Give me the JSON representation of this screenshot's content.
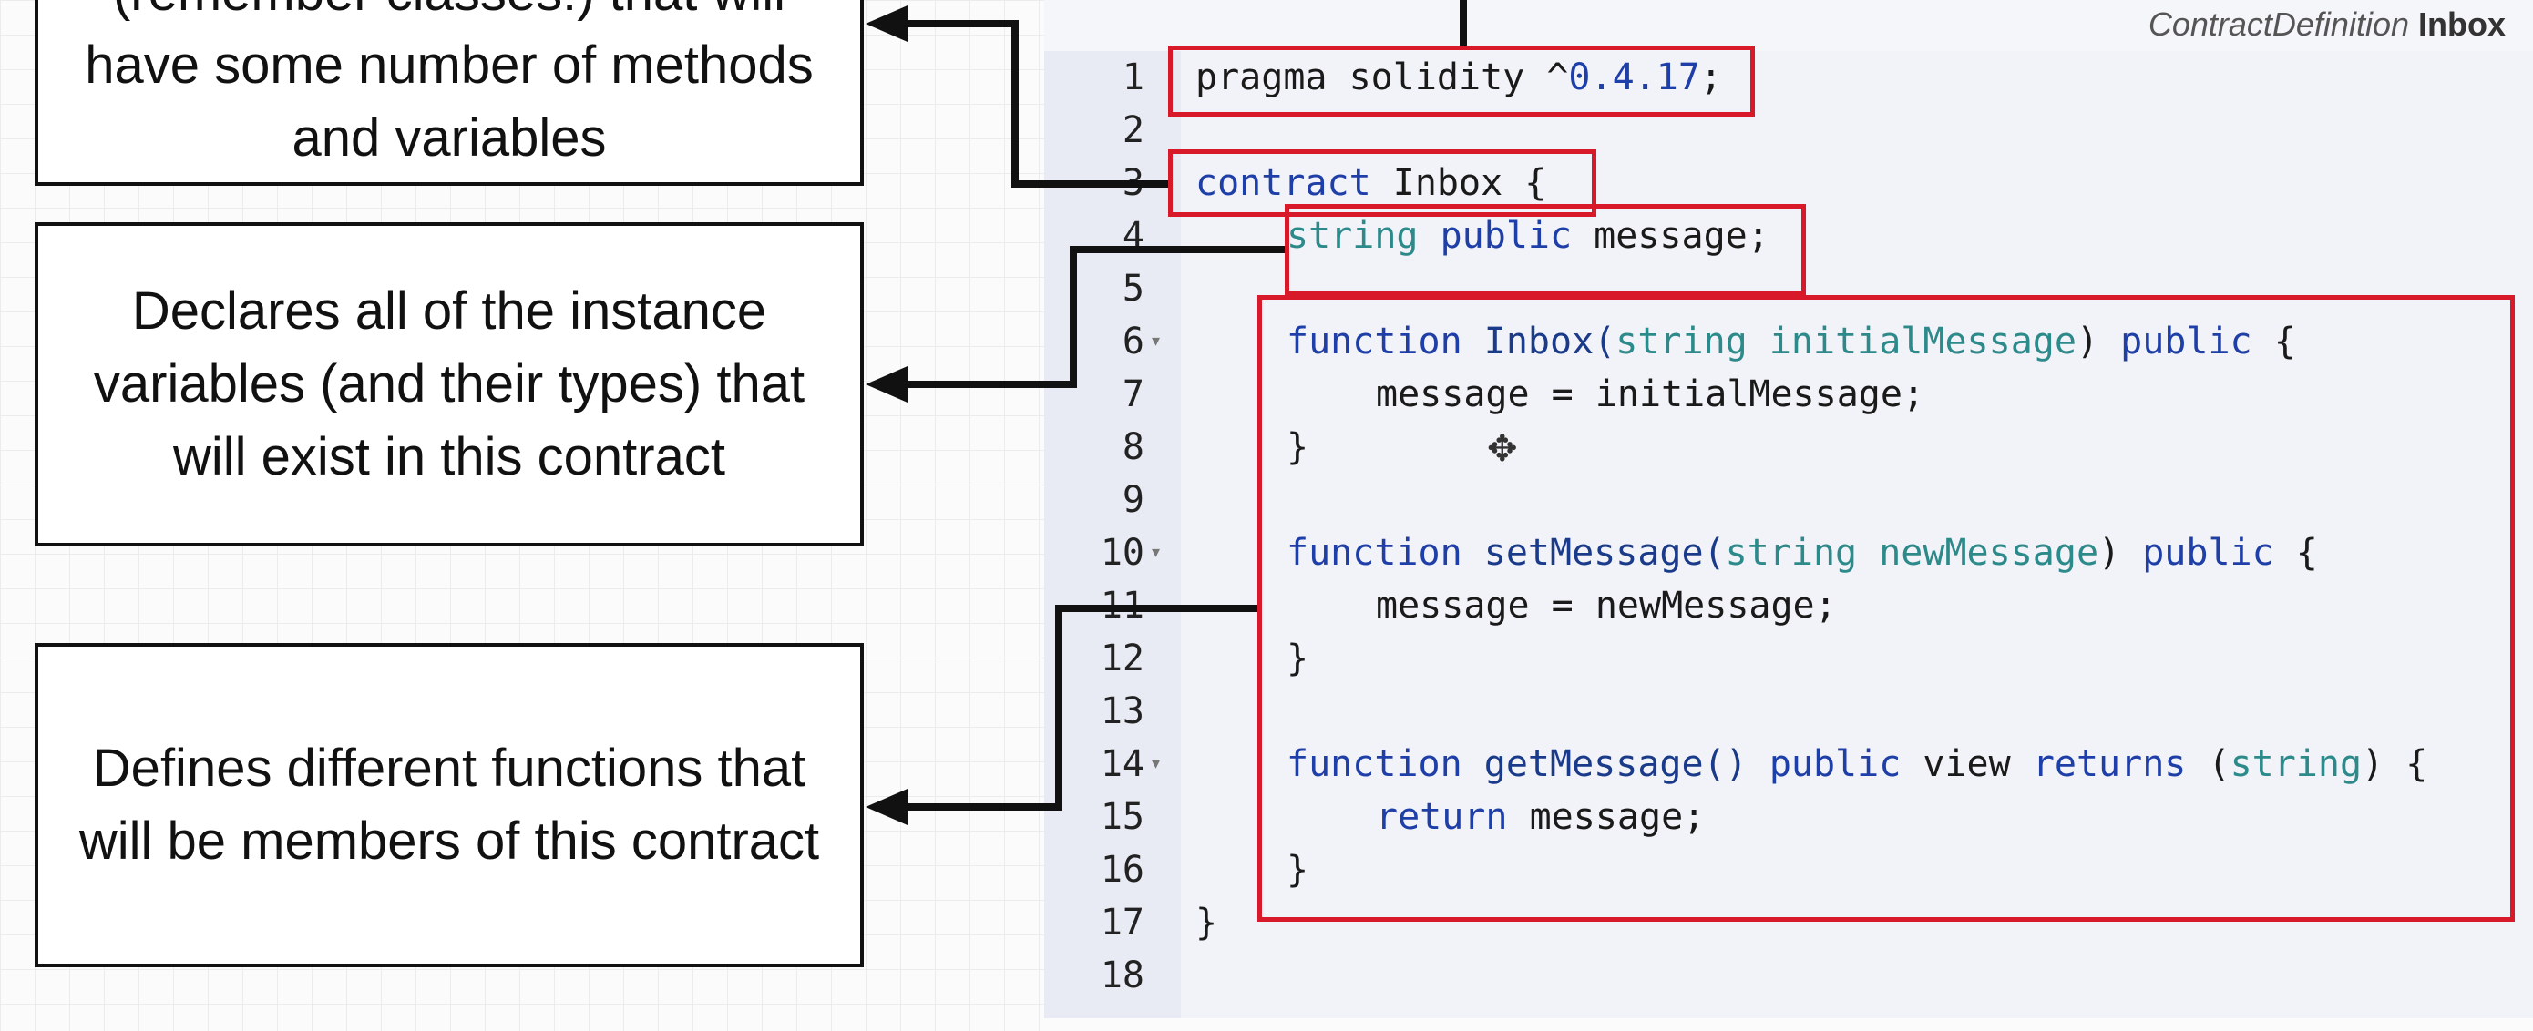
{
  "tab": {
    "context": "ContractDefinition",
    "file": "Inbox"
  },
  "callouts": {
    "top": "(remember classes!) that will have some number of methods and variables",
    "middle": "Declares all of the instance variables (and their types) that will exist in this contract",
    "bottom": "Defines different functions that will be members of this contract"
  },
  "code": {
    "line_numbers": [
      "1",
      "2",
      "3",
      "4",
      "5",
      "6",
      "7",
      "8",
      "9",
      "10",
      "11",
      "12",
      "13",
      "14",
      "15",
      "16",
      "17",
      "18"
    ],
    "l1_pragma": "pragma solidity ^",
    "l1_version": "0.4.17",
    "l1_end": ";",
    "l3_kw": "contract",
    "l3_name": " Inbox ",
    "l3_brace": "{",
    "l4_type": "string",
    "l4_mod": " public",
    "l4_rest": " message;",
    "l6_kw": "function",
    "l6_name": " Inbox(",
    "l6_type": "string",
    "l6_param": " initialMessage",
    "l6_close": ") ",
    "l6_mod": "public",
    "l6_brace": " {",
    "l7": "message = initialMessage;",
    "close_brace": "}",
    "l10_kw": "function",
    "l10_name": " setMessage(",
    "l10_type": "string",
    "l10_param": " newMessage",
    "l10_close": ") ",
    "l10_mod": "public",
    "l10_brace": " {",
    "l11": "message = newMessage;",
    "l14_kw": "function",
    "l14_name": " getMessage() ",
    "l14_mod": "public",
    "l14_view": " view ",
    "l14_ret": "returns",
    "l14_paren": " (",
    "l14_type": "string",
    "l14_end": ") {",
    "l15_kw": "return",
    "l15_rest": " message;",
    "l17": "}"
  },
  "colors": {
    "highlight": "#d7192a",
    "keyword": "#1f3fa8",
    "type": "#2d8a8a"
  },
  "icons": {
    "cursor": "move-cursor-icon",
    "fold": "fold-arrow-icon"
  }
}
